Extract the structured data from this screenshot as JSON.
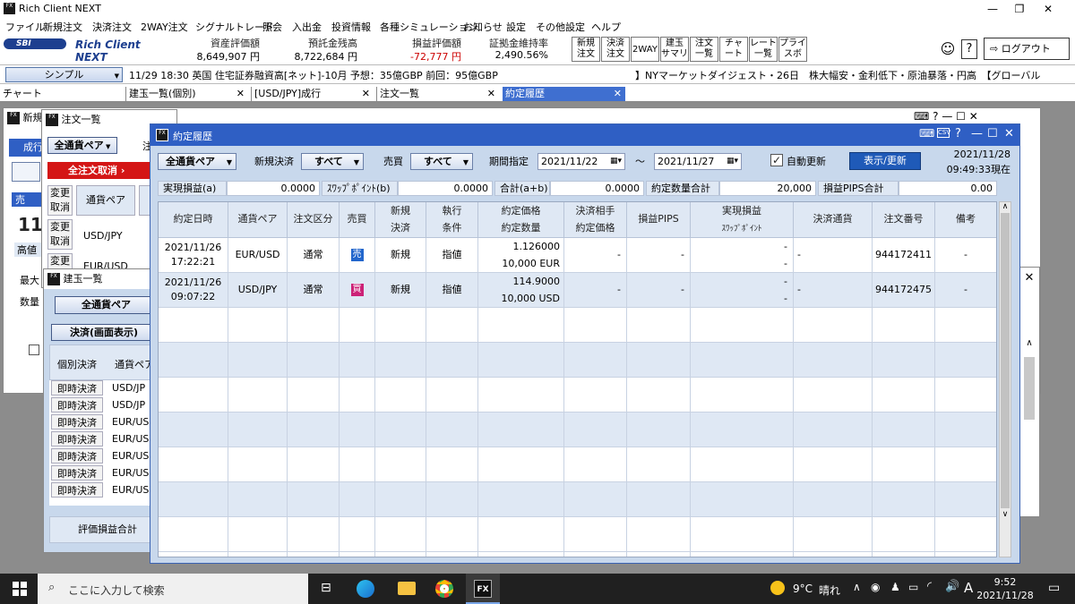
{
  "app": {
    "title": "Rich Client NEXT",
    "fx": "FX"
  },
  "menu": [
    "ファイル",
    "新規注文",
    "決済注文",
    "2WAY注文",
    "シグナルトレード",
    "照会",
    "入出金",
    "投資情報",
    "各種シミュレーション",
    "お知らせ",
    "設定",
    "その他設定",
    "ヘルプ"
  ],
  "brand": {
    "sbi": "SBI",
    "name": "Rich Client NEXT"
  },
  "metrics": [
    {
      "label": "資産評価額",
      "value": "8,649,907 円",
      "color": "#000000"
    },
    {
      "label": "預託金残高",
      "value": "8,722,684 円",
      "color": "#000000"
    },
    {
      "label": "損益評価額",
      "value": "-72,777 円",
      "color": "#cc0000"
    },
    {
      "label": "証拠金維持率",
      "value": "2,490.56%",
      "color": "#000000"
    }
  ],
  "toolbar": [
    {
      "l1": "新規",
      "l2": "注文"
    },
    {
      "l1": "決済",
      "l2": "注文"
    },
    {
      "l1": "2WAY",
      "l2": ""
    },
    {
      "l1": "建玉",
      "l2": "サマリ"
    },
    {
      "l1": "注文",
      "l2": "一覧"
    },
    {
      "l1": "チャ",
      "l2": "ート"
    },
    {
      "l1": "レート",
      "l2": "一覧"
    },
    {
      "l1": "プライ",
      "l2": "スボ"
    }
  ],
  "logout": "ログアウト",
  "mode": "シンプル",
  "news": {
    "left": "11/29 18:30 英国 住宅証券融資高[ネット]-10月 予想：35億GBP 前回：95億GBP",
    "right": "】NYマーケットダイジェスト・26日　株大幅安・金利低下・原油暴落・円高　【グローバル"
  },
  "tabs": [
    "チャート",
    "建玉一覧(個別)",
    "[USD/JPY]成行",
    "注文一覧",
    "約定履歴"
  ],
  "bg_window": {
    "title": "新規",
    "side": "成行",
    "sell_label": "売",
    "bid": "11",
    "high_label": "高値",
    "max_label": "最大",
    "qty_label": "数量"
  },
  "order_list": {
    "title": "注文一覧",
    "pair": "全通貨ペア",
    "cancel_all": "全注文取消",
    "change": "変更",
    "cancel": "取消",
    "pair_header": "通貨ペア",
    "row_pair": "USD/JPY",
    "row_pair2": "EUR/USD",
    "col_trigger": "注"
  },
  "position_list": {
    "title": "建玉一覧",
    "pair": "全通貨ペア",
    "settle_btn": "決済(画面表示)",
    "h1": "個別決済",
    "h2": "通貨ペア",
    "row_btn": "即時決済",
    "pairs": [
      "USD/JP",
      "USD/JP",
      "EUR/US",
      "EUR/US",
      "EUR/US",
      "EUR/US",
      "EUR/US"
    ],
    "total": "評価損益合計"
  },
  "execution": {
    "title": "約定履歴",
    "pair": "全通貨ペア",
    "new_settle_label": "新規決済",
    "new_settle_value": "すべて",
    "side_label": "売買",
    "side_value": "すべて",
    "period_label": "期間指定",
    "date_from": "2021/11/22",
    "date_to": "2021/11/27",
    "tilde": "～",
    "auto_update": "自動更新",
    "refresh": "表示/更新",
    "timestamp1": "2021/11/28",
    "timestamp2": "09:49:33現在",
    "summary": [
      {
        "label": "実現損益(a)",
        "value": "0.0000"
      },
      {
        "label": "ｽﾜｯﾌﾟﾎﾟｲﾝﾄ(b)",
        "value": "0.0000"
      },
      {
        "label": "合計(a+b)",
        "value": "0.0000"
      },
      {
        "label": "約定数量合計",
        "value": "20,000"
      },
      {
        "label": "損益PIPS合計",
        "value": "0.00"
      }
    ],
    "headers": {
      "date": "約定日時",
      "pair": "通貨ペア",
      "order_type": "注文区分",
      "side": "売買",
      "new1": "新規",
      "new2": "決済",
      "exec1": "執行",
      "exec2": "条件",
      "price1": "約定価格",
      "price2": "約定数量",
      "cp1": "決済相手",
      "cp2": "約定価格",
      "pips": "損益PIPS",
      "pl1": "実現損益",
      "pl2": "ｽﾜｯﾌﾟﾎﾟｲﾝﾄ",
      "ccy": "決済通貨",
      "order_no": "注文番号",
      "note": "備考"
    },
    "rows": [
      {
        "date": "2021/11/26",
        "time": "17:22:21",
        "pair": "EUR/USD",
        "type": "通常",
        "side": "売",
        "side_color": "#2266cc",
        "new": "新規",
        "exec": "指値",
        "price": "1.126000",
        "qty": "10,000 EUR",
        "cp": "-",
        "pips": "-",
        "pl": "-",
        "swap": "-",
        "ccy": "-",
        "order_no": "944172411",
        "note": "-"
      },
      {
        "date": "2021/11/26",
        "time": "09:07:22",
        "pair": "USD/JPY",
        "type": "通常",
        "side": "買",
        "side_color": "#cc2277",
        "new": "新規",
        "exec": "指値",
        "price": "114.9000",
        "qty": "10,000 USD",
        "cp": "-",
        "pips": "-",
        "pl": "-",
        "swap": "-",
        "ccy": "-",
        "order_no": "944172475",
        "note": "-"
      }
    ]
  },
  "taskbar": {
    "search": "ここに入力して検索",
    "temp": "9°C",
    "weather": "晴れ",
    "ime": "A",
    "time": "9:52",
    "date": "2021/11/28"
  }
}
